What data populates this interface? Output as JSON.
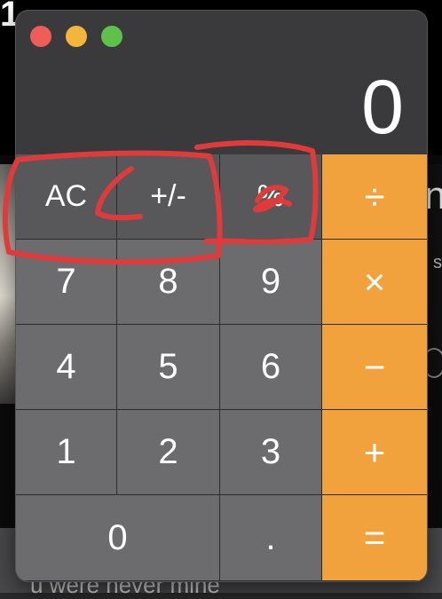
{
  "background": {
    "top_text": "1",
    "right_text_big": "n",
    "right_text_small": "s",
    "caption": "u were never mine"
  },
  "window": {
    "traffic_lights": [
      "close",
      "minimize",
      "maximize"
    ],
    "display_value": "0"
  },
  "keys": {
    "clear": "AC",
    "plus_minus": "+/-",
    "percent": "%",
    "divide": "÷",
    "seven": "7",
    "eight": "8",
    "nine": "9",
    "multiply": "×",
    "four": "4",
    "five": "5",
    "six": "6",
    "subtract": "−",
    "one": "1",
    "two": "2",
    "three": "3",
    "add": "+",
    "zero": "0",
    "decimal": ".",
    "equals": "="
  },
  "colors": {
    "operator_key": "#f2a23c",
    "function_key": "#58585a",
    "number_key": "#6c6c6e",
    "annotation": "#e03a3a"
  }
}
